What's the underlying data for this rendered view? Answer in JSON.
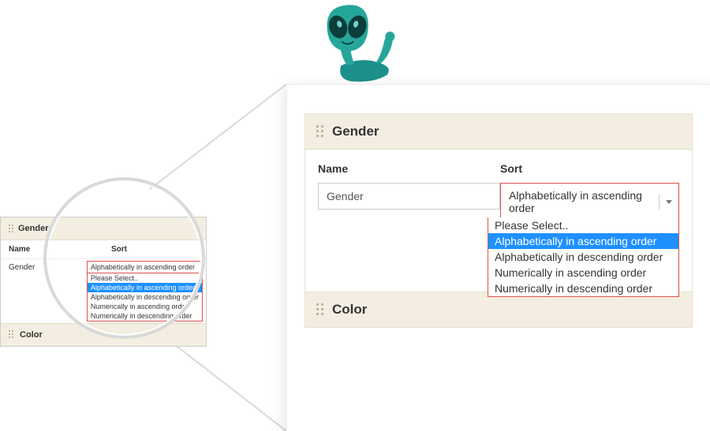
{
  "sections": {
    "gender": {
      "title": "Gender",
      "name_col": "Name",
      "sort_col": "Sort",
      "name_value": "Gender",
      "sort_value": "Alphabetically in ascending order",
      "options": [
        "Please Select..",
        "Alphabetically in ascending order",
        "Alphabetically in descending order",
        "Numerically in ascending order",
        "Numerically in descending order"
      ],
      "selected_index": 1
    },
    "color": {
      "title": "Color"
    }
  }
}
